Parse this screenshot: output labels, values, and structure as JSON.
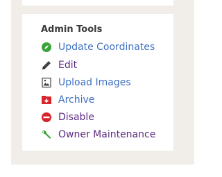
{
  "admin_tools": {
    "heading": "Admin Tools",
    "items": [
      {
        "label": "Update Coordinates",
        "icon": "compass-icon"
      },
      {
        "label": "Edit",
        "icon": "pencil-icon"
      },
      {
        "label": "Upload Images",
        "icon": "image-icon"
      },
      {
        "label": "Archive",
        "icon": "archive-icon"
      },
      {
        "label": "Disable",
        "icon": "no-entry-icon"
      },
      {
        "label": "Owner Maintenance",
        "icon": "wrench-icon"
      }
    ]
  },
  "colors": {
    "panel_bg": "#f1eeea",
    "link_blue": "#3d6fc2",
    "link_visited": "#5c2b82",
    "green": "#3aa33a",
    "red": "#d8242b"
  }
}
